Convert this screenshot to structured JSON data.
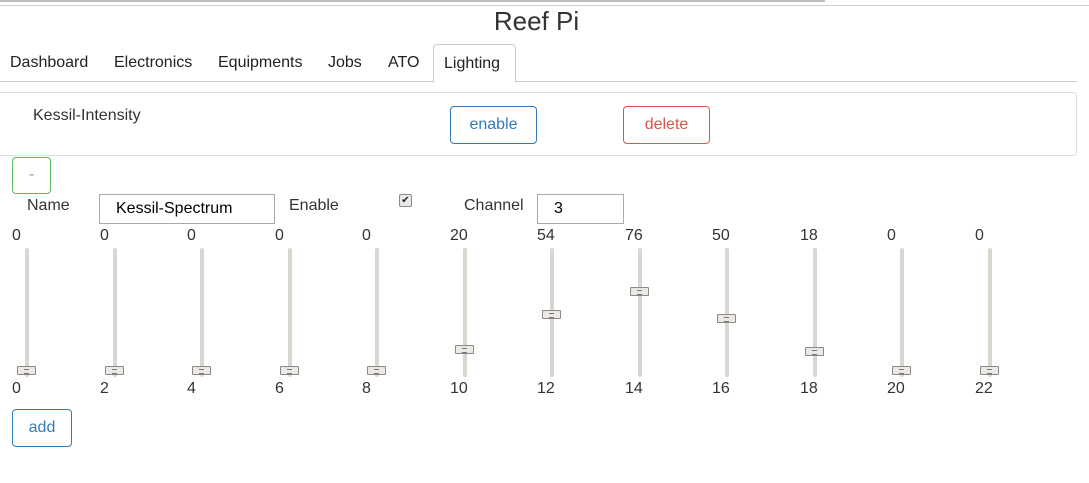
{
  "app": {
    "title": "Reef Pi"
  },
  "tabs": [
    {
      "label": "Dashboard",
      "active": false
    },
    {
      "label": "Electronics",
      "active": false
    },
    {
      "label": "Equipments",
      "active": false
    },
    {
      "label": "Jobs",
      "active": false
    },
    {
      "label": "ATO",
      "active": false
    },
    {
      "label": "Lighting",
      "active": true
    }
  ],
  "existing_light": {
    "name": "Kessil-Intensity",
    "enable_label": "enable",
    "delete_label": "delete"
  },
  "form": {
    "collapse_label": "-",
    "name_label": "Name",
    "name_value": "Kessil-Spectrum",
    "enable_label": "Enable",
    "enabled": true,
    "channel_label": "Channel",
    "channel_value": "3",
    "add_label": "add"
  },
  "sliders": [
    {
      "hour": "0",
      "value": "0"
    },
    {
      "hour": "2",
      "value": "0"
    },
    {
      "hour": "4",
      "value": "0"
    },
    {
      "hour": "6",
      "value": "0"
    },
    {
      "hour": "8",
      "value": "0"
    },
    {
      "hour": "10",
      "value": "20"
    },
    {
      "hour": "12",
      "value": "54"
    },
    {
      "hour": "14",
      "value": "76"
    },
    {
      "hour": "16",
      "value": "50"
    },
    {
      "hour": "18",
      "value": "18"
    },
    {
      "hour": "20",
      "value": "0"
    },
    {
      "hour": "22",
      "value": "0"
    }
  ],
  "slider_range": [
    0,
    100
  ],
  "colors": {
    "primary": "#337ab7",
    "danger": "#d9534f",
    "success": "#5cb85c",
    "track": "#dad5cf"
  }
}
